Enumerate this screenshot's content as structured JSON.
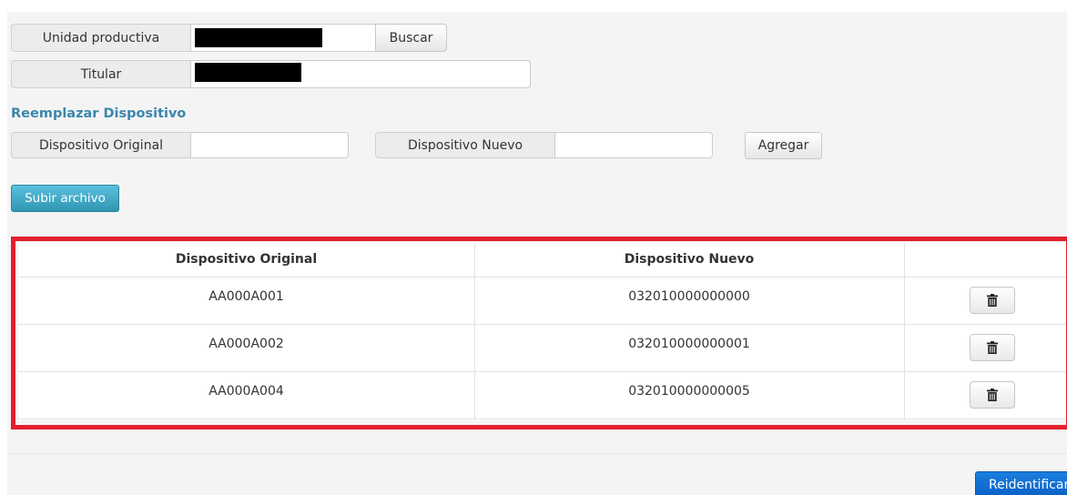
{
  "form": {
    "unidad_label": "Unidad productiva",
    "unidad_value": "",
    "buscar_label": "Buscar",
    "titular_label": "Titular",
    "titular_value": ""
  },
  "section": {
    "title": "Reemplazar Dispositivo",
    "original_label": "Dispositivo Original",
    "original_value": "",
    "nuevo_label": "Dispositivo Nuevo",
    "nuevo_value": "",
    "agregar_label": "Agregar",
    "subir_label": "Subir archivo"
  },
  "table": {
    "headers": [
      "Dispositivo Original",
      "Dispositivo Nuevo",
      ""
    ],
    "rows": [
      {
        "original": "AA000A001",
        "nuevo": "032010000000000"
      },
      {
        "original": "AA000A002",
        "nuevo": "032010000000001"
      },
      {
        "original": "AA000A004",
        "nuevo": "032010000000005"
      }
    ],
    "row_action_icon": "trash-icon"
  },
  "footer": {
    "reidentificar_label": "Reidentificar"
  },
  "colors": {
    "section_title": "#3a87ad",
    "highlight_frame": "#e2202c",
    "info_button": "#2f96b4",
    "primary_button": "#0a5fc4"
  }
}
